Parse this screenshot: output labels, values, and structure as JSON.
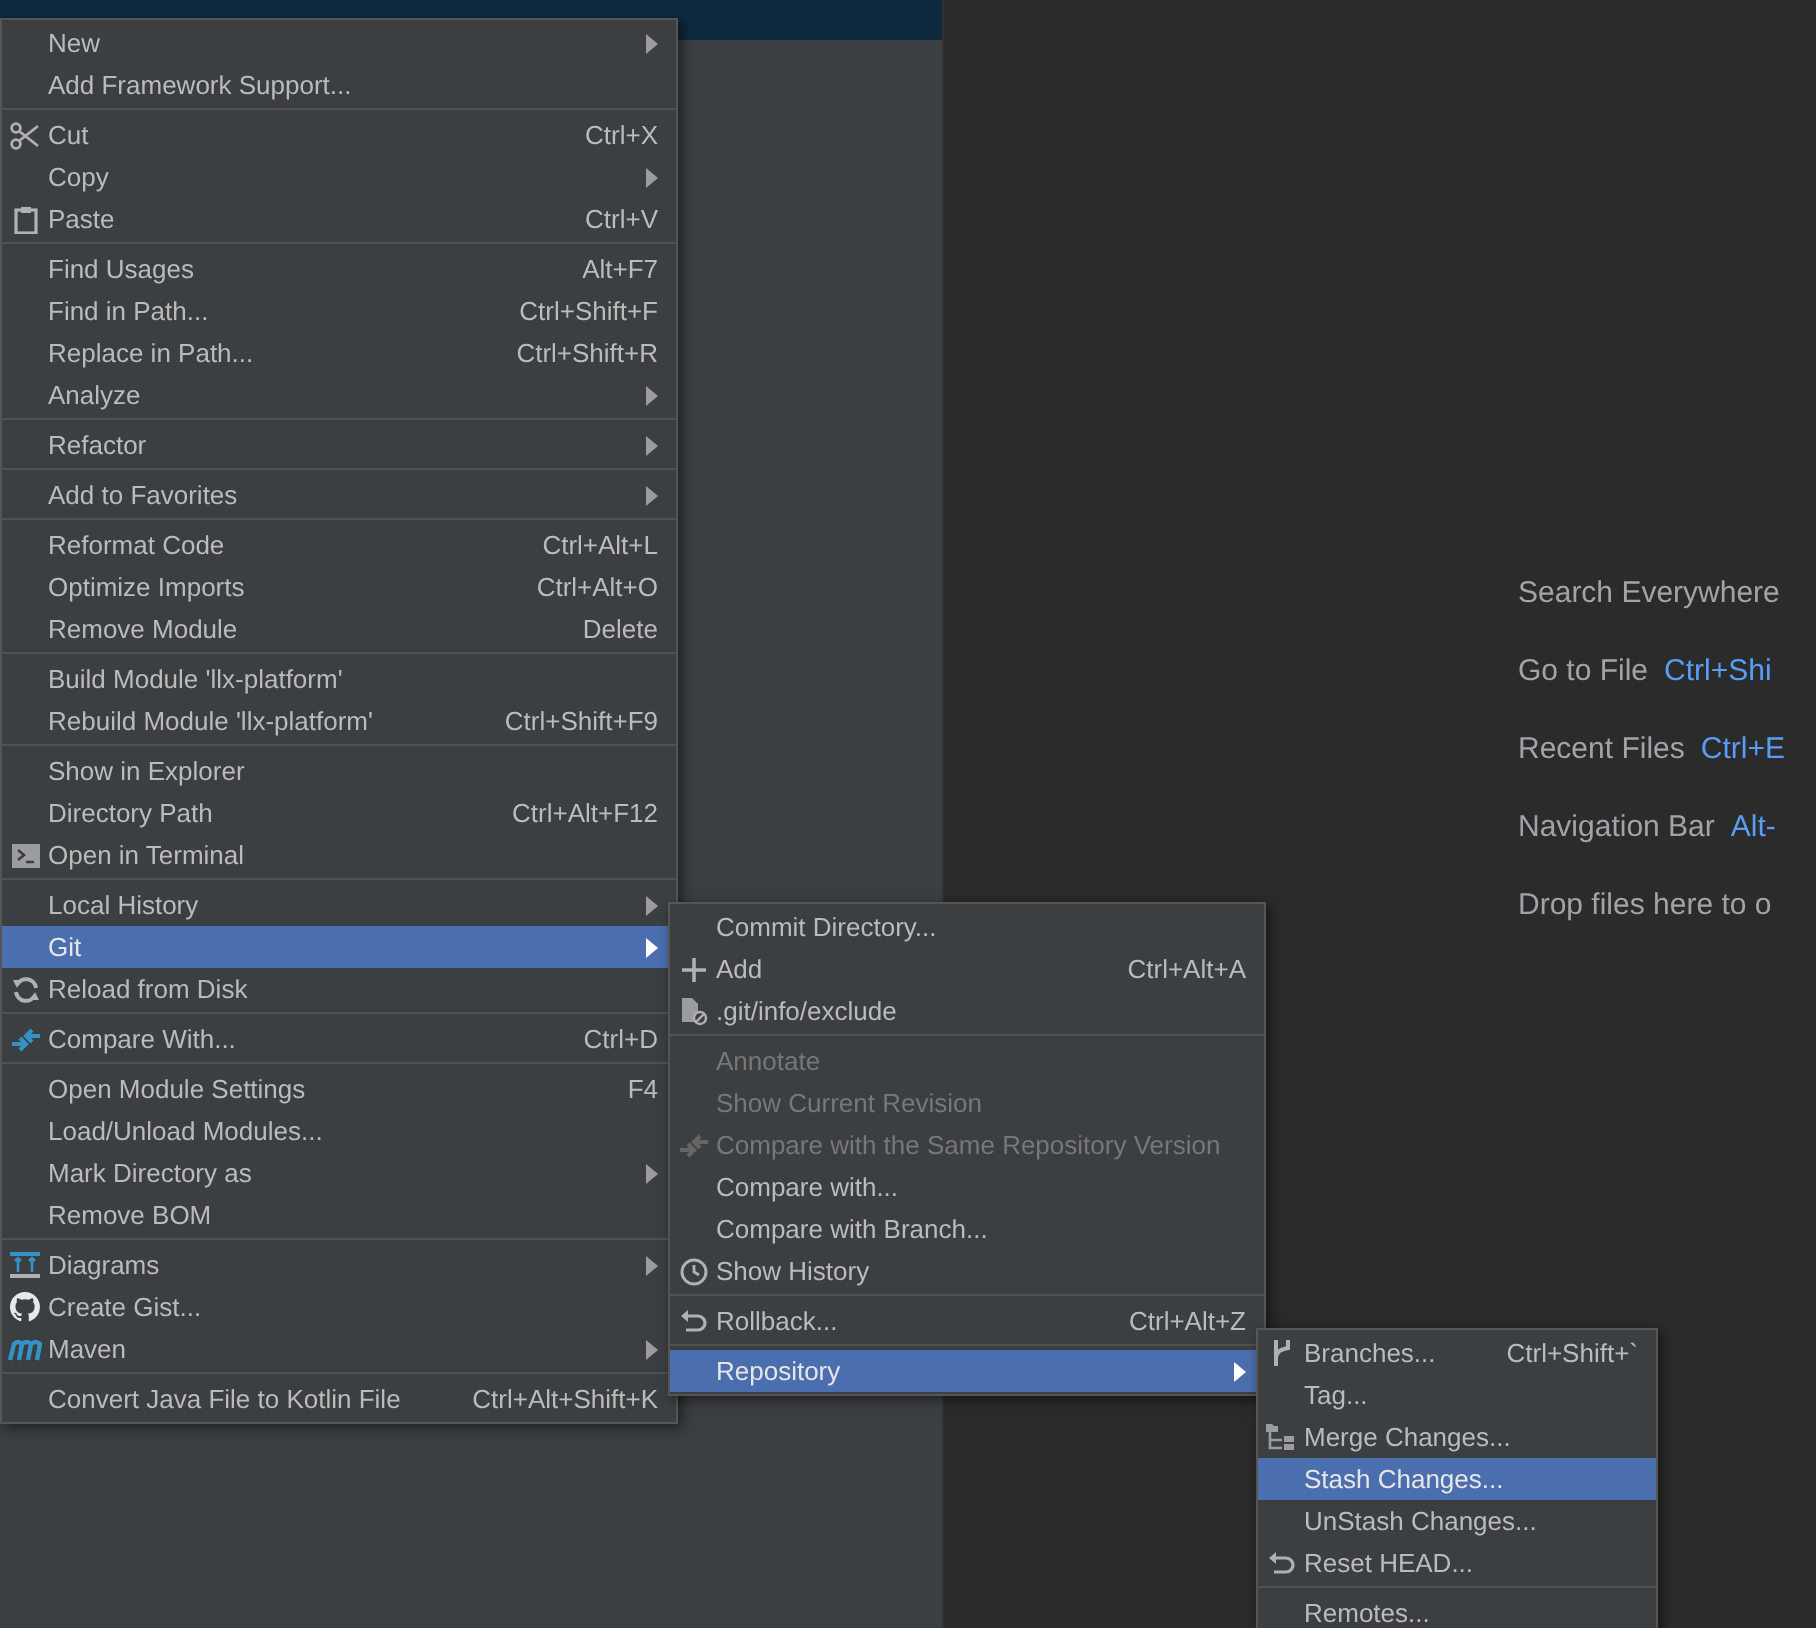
{
  "context_menu": {
    "sections": [
      [
        {
          "label": "New",
          "submenu": true,
          "selected": false
        },
        {
          "label": "Add Framework Support...",
          "submenu": false,
          "selected": false
        }
      ],
      [
        {
          "label": "Cut",
          "shortcut": "Ctrl+X",
          "submenu": false,
          "selected": false
        },
        {
          "label": "Copy",
          "submenu": true,
          "selected": false
        },
        {
          "label": "Paste",
          "shortcut": "Ctrl+V",
          "submenu": false,
          "selected": false
        }
      ],
      [
        {
          "label": "Find Usages",
          "shortcut": "Alt+F7",
          "submenu": false,
          "selected": false
        },
        {
          "label": "Find in Path...",
          "shortcut": "Ctrl+Shift+F",
          "submenu": false,
          "selected": false
        },
        {
          "label": "Replace in Path...",
          "shortcut": "Ctrl+Shift+R",
          "submenu": false,
          "selected": false
        },
        {
          "label": "Analyze",
          "submenu": true,
          "selected": false
        }
      ],
      [
        {
          "label": "Refactor",
          "submenu": true,
          "selected": false
        }
      ],
      [
        {
          "label": "Add to Favorites",
          "submenu": true,
          "selected": false
        }
      ],
      [
        {
          "label": "Reformat Code",
          "shortcut": "Ctrl+Alt+L",
          "submenu": false,
          "selected": false
        },
        {
          "label": "Optimize Imports",
          "shortcut": "Ctrl+Alt+O",
          "submenu": false,
          "selected": false
        },
        {
          "label": "Remove Module",
          "shortcut": "Delete",
          "submenu": false,
          "selected": false
        }
      ],
      [
        {
          "label": "Build Module 'llx-platform'",
          "submenu": false,
          "selected": false
        },
        {
          "label": "Rebuild Module 'llx-platform'",
          "shortcut": "Ctrl+Shift+F9",
          "submenu": false,
          "selected": false
        }
      ],
      [
        {
          "label": "Show in Explorer",
          "submenu": false,
          "selected": false
        },
        {
          "label": "Directory Path",
          "shortcut": "Ctrl+Alt+F12",
          "submenu": false,
          "selected": false
        },
        {
          "label": "Open in Terminal",
          "submenu": false,
          "selected": false
        }
      ],
      [
        {
          "label": "Local History",
          "submenu": true,
          "selected": false
        },
        {
          "label": "Git",
          "submenu": true,
          "selected": true
        },
        {
          "label": "Reload from Disk",
          "submenu": false,
          "selected": false
        }
      ],
      [
        {
          "label": "Compare With...",
          "shortcut": "Ctrl+D",
          "submenu": false,
          "selected": false
        }
      ],
      [
        {
          "label": "Open Module Settings",
          "shortcut": "F4",
          "submenu": false,
          "selected": false
        },
        {
          "label": "Load/Unload Modules...",
          "submenu": false,
          "selected": false
        },
        {
          "label": "Mark Directory as",
          "submenu": true,
          "selected": false
        },
        {
          "label": "Remove BOM",
          "submenu": false,
          "selected": false
        }
      ],
      [
        {
          "label": "Diagrams",
          "submenu": true,
          "selected": false
        },
        {
          "label": "Create Gist...",
          "submenu": false,
          "selected": false
        },
        {
          "label": "Maven",
          "submenu": true,
          "selected": false
        }
      ],
      [
        {
          "label": "Convert Java File to Kotlin File",
          "shortcut": "Ctrl+Alt+Shift+K",
          "submenu": false,
          "selected": false
        }
      ]
    ]
  },
  "git_submenu": {
    "sections": [
      [
        {
          "label": "Commit Directory...",
          "submenu": false,
          "selected": false,
          "disabled": false
        },
        {
          "label": "Add",
          "shortcut": "Ctrl+Alt+A",
          "submenu": false,
          "selected": false,
          "disabled": false
        },
        {
          "label": ".git/info/exclude",
          "submenu": false,
          "selected": false,
          "disabled": false
        }
      ],
      [
        {
          "label": "Annotate",
          "submenu": false,
          "selected": false,
          "disabled": true
        },
        {
          "label": "Show Current Revision",
          "submenu": false,
          "selected": false,
          "disabled": true
        },
        {
          "label": "Compare with the Same Repository Version",
          "submenu": false,
          "selected": false,
          "disabled": true
        },
        {
          "label": "Compare with...",
          "submenu": false,
          "selected": false,
          "disabled": false
        },
        {
          "label": "Compare with Branch...",
          "submenu": false,
          "selected": false,
          "disabled": false
        },
        {
          "label": "Show History",
          "submenu": false,
          "selected": false,
          "disabled": false
        }
      ],
      [
        {
          "label": "Rollback...",
          "shortcut": "Ctrl+Alt+Z",
          "submenu": false,
          "selected": false,
          "disabled": false
        }
      ],
      [
        {
          "label": "Repository",
          "submenu": true,
          "selected": true,
          "disabled": false
        }
      ]
    ]
  },
  "repository_submenu": {
    "sections": [
      [
        {
          "label": "Branches...",
          "shortcut": "Ctrl+Shift+`",
          "submenu": false,
          "selected": false
        },
        {
          "label": "Tag...",
          "submenu": false,
          "selected": false
        },
        {
          "label": "Merge Changes...",
          "submenu": false,
          "selected": false
        },
        {
          "label": "Stash Changes...",
          "submenu": false,
          "selected": true
        },
        {
          "label": "UnStash Changes...",
          "submenu": false,
          "selected": false
        },
        {
          "label": "Reset HEAD...",
          "submenu": false,
          "selected": false
        }
      ],
      [
        {
          "label": "Remotes...",
          "submenu": false,
          "selected": false
        }
      ]
    ]
  },
  "editor_hints": [
    {
      "label": "Search Everywhere"
    },
    {
      "label": "Go to File",
      "shortcut": "Ctrl+Shi"
    },
    {
      "label": "Recent Files",
      "shortcut": "Ctrl+E"
    },
    {
      "label": "Navigation Bar",
      "shortcut": "Alt-"
    },
    {
      "label": "Drop files here to o"
    }
  ]
}
